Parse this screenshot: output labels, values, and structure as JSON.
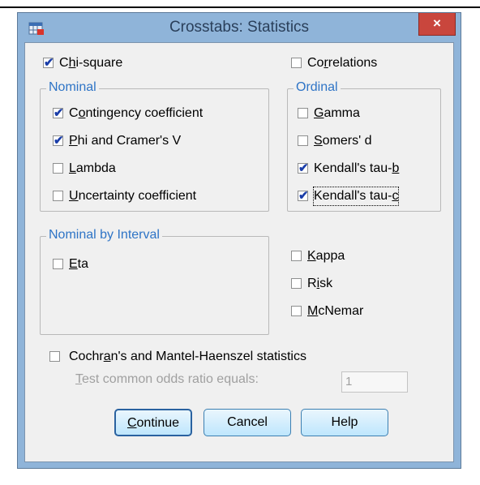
{
  "window": {
    "title": "Crosstabs: Statistics",
    "close_glyph": "×"
  },
  "chi_square": {
    "pre": "C",
    "ul": "h",
    "post": "i-square",
    "checked": true
  },
  "correlations": {
    "pre": "Co",
    "ul": "r",
    "post": "relations",
    "checked": false
  },
  "nominal": {
    "legend": "Nominal",
    "contingency": {
      "pre": "C",
      "ul": "o",
      "post": "ntingency coefficient",
      "checked": true
    },
    "phi": {
      "pre": "",
      "ul": "P",
      "post": "hi and Cramer's V",
      "checked": true
    },
    "lambda": {
      "pre": "",
      "ul": "L",
      "post": "ambda",
      "checked": false
    },
    "uncertainty": {
      "pre": "",
      "ul": "U",
      "post": "ncertainty coefficient",
      "checked": false
    }
  },
  "ordinal": {
    "legend": "Ordinal",
    "gamma": {
      "pre": "",
      "ul": "G",
      "post": "amma",
      "checked": false
    },
    "somers": {
      "pre": "",
      "ul": "S",
      "post": "omers' d",
      "checked": false
    },
    "tau_b": {
      "pre": "Kendall's tau-",
      "ul": "b",
      "post": "",
      "checked": true
    },
    "tau_c": {
      "pre": "Kendall's tau-",
      "ul": "c",
      "post": "",
      "checked": true
    }
  },
  "nominal_by_interval": {
    "legend": "Nominal by Interval",
    "eta": {
      "pre": "",
      "ul": "E",
      "post": "ta",
      "checked": false
    }
  },
  "kappa": {
    "pre": "",
    "ul": "K",
    "post": "appa",
    "checked": false
  },
  "risk": {
    "pre": "R",
    "ul": "i",
    "post": "sk",
    "checked": false
  },
  "mcnemar": {
    "pre": "",
    "ul": "M",
    "post": "cNemar",
    "checked": false
  },
  "cochran": {
    "pre": "Cochr",
    "ul": "a",
    "post": "n's and Mantel-Haenszel statistics",
    "checked": false
  },
  "odds_ratio": {
    "pre": "",
    "ul": "T",
    "post": "est common odds ratio equals:",
    "value": "1"
  },
  "buttons": {
    "continue": {
      "pre": "",
      "ul": "C",
      "post": "ontinue"
    },
    "cancel": "Cancel",
    "help": "Help"
  },
  "check_glyph": "✔",
  "colors": {
    "titlebar": "#8fb4d9",
    "close": "#c9463d",
    "legend": "#2e74c6",
    "check": "#1a3da8"
  }
}
